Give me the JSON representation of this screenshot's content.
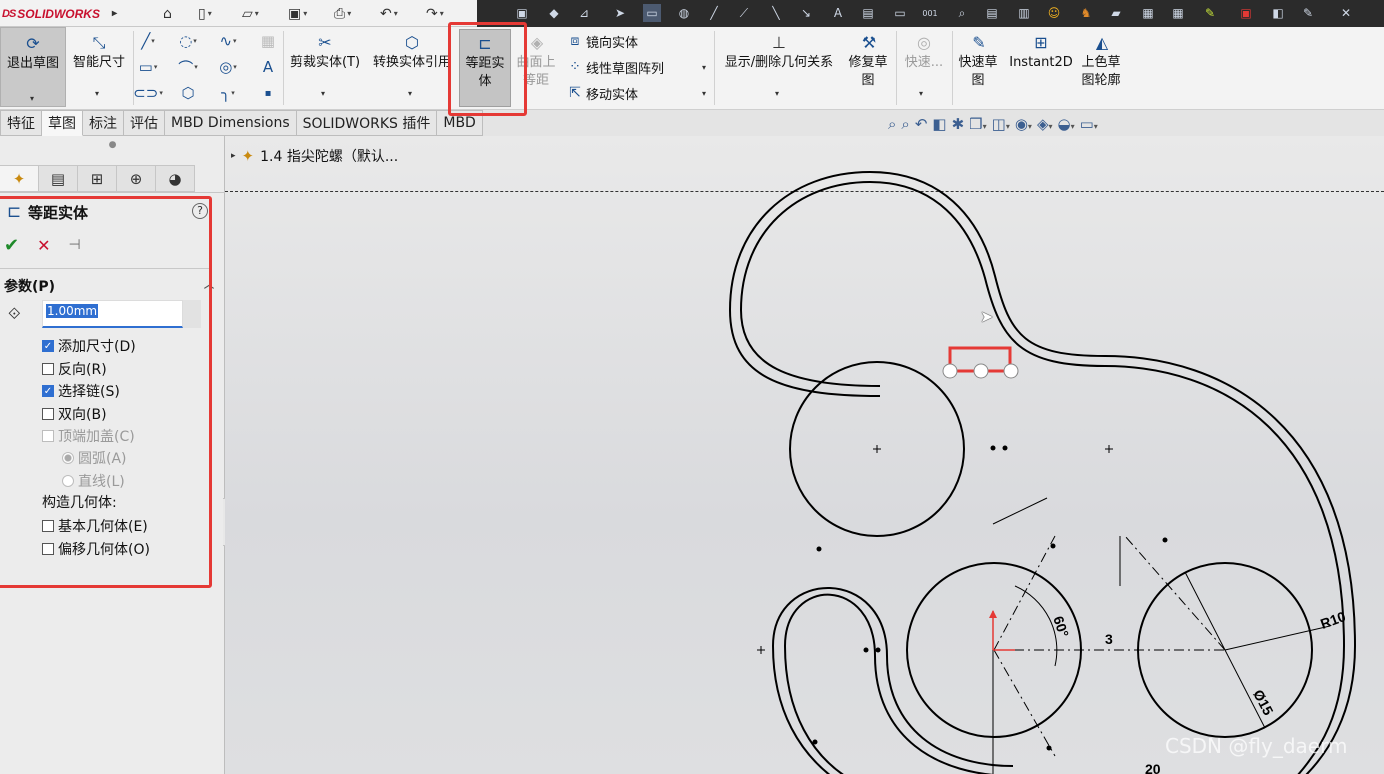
{
  "app": {
    "name": "SOLIDWORKS",
    "brand_prefix": "DS"
  },
  "colors": {
    "accent": "#2f6fd1",
    "highlight_red": "#e53935",
    "ok_green": "#1f8a2a",
    "cancel_red": "#c8102e",
    "brand_red": "#c8102e"
  },
  "quick_access": [
    "home-icon",
    "new-document-icon",
    "open-icon",
    "save-icon",
    "print-icon",
    "undo-icon",
    "redo-icon"
  ],
  "ribbon": {
    "exit_sketch": "退出草图",
    "smart_dimension": "智能尺寸",
    "trim": "剪裁实体(T)",
    "convert": "转换实体引用",
    "offset": "等距实体",
    "surface_offset": "曲面上等距",
    "mirror": "镜向实体",
    "linear_pattern": "线性草图阵列",
    "move": "移动实体",
    "display_relations": "显示/删除几何关系",
    "repair": "修复草图",
    "quick_snaps": "快速...",
    "rapid_sketch": "快速草图",
    "instant2d": "Instant2D",
    "shaded_contours": "上色草图轮廓"
  },
  "tabs": [
    "特征",
    "草图",
    "标注",
    "评估",
    "MBD Dimensions",
    "SOLIDWORKS 插件",
    "MBD"
  ],
  "active_tab": "草图",
  "tree": {
    "item": "1.4 指尖陀螺（默认..."
  },
  "pm": {
    "title": "等距实体",
    "help": "?",
    "group": "参数(P)",
    "distance": "1.00mm",
    "options": [
      {
        "label": "添加尺寸(D)",
        "checked": true,
        "enabled": true
      },
      {
        "label": "反向(R)",
        "checked": false,
        "enabled": true
      },
      {
        "label": "选择链(S)",
        "checked": true,
        "enabled": true
      },
      {
        "label": "双向(B)",
        "checked": false,
        "enabled": true
      },
      {
        "label": "顶端加盖(C)",
        "checked": false,
        "enabled": false
      }
    ],
    "radios": [
      {
        "label": "圆弧(A)",
        "selected": true
      },
      {
        "label": "直线(L)",
        "selected": false
      }
    ],
    "construction_label": "构造几何体:",
    "construction": [
      {
        "label": "基本几何体(E)",
        "checked": false
      },
      {
        "label": "偏移几何体(O)",
        "checked": false
      }
    ]
  },
  "sketch": {
    "dims": {
      "angle": "60°",
      "offset": "3",
      "radius": "R10",
      "diameter": "Ø15",
      "bottom": "20"
    }
  },
  "watermark": "CSDN @fly_daerm"
}
